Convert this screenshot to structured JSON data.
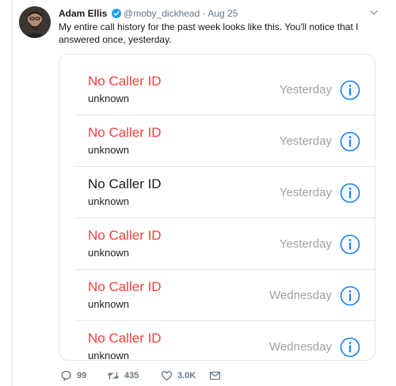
{
  "tweet": {
    "author_name": "Adam Ellis",
    "handle": "@moby_dickhead",
    "separator": "·",
    "date": "Aug 25",
    "text": "My entire call history for the past week looks like this. You'll notice that I answered once, yesterday."
  },
  "call_history": [
    {
      "name": "No Caller ID",
      "type": "unknown",
      "date": "Yesterday",
      "missed": true
    },
    {
      "name": "No Caller ID",
      "type": "unknown",
      "date": "Yesterday",
      "missed": true
    },
    {
      "name": "No Caller ID",
      "type": "unknown",
      "date": "Yesterday",
      "missed": false
    },
    {
      "name": "No Caller ID",
      "type": "unknown",
      "date": "Yesterday",
      "missed": true
    },
    {
      "name": "No Caller ID",
      "type": "unknown",
      "date": "Wednesday",
      "missed": true
    },
    {
      "name": "No Caller ID",
      "type": "unknown",
      "date": "Wednesday",
      "missed": true
    }
  ],
  "actions": {
    "reply_count": "99",
    "retweet_count": "435",
    "like_count": "3.0K"
  },
  "colors": {
    "missed": "#fa3e3e",
    "answered": "#1b1b1b",
    "info_blue": "#147efb",
    "verified_blue": "#1da1f2",
    "meta_gray": "#657786"
  },
  "icons": {
    "verified": "verified-badge-icon",
    "chevron": "chevron-down-icon",
    "info": "info-icon",
    "reply": "reply-icon",
    "retweet": "retweet-icon",
    "like": "heart-icon",
    "message": "envelope-icon"
  }
}
